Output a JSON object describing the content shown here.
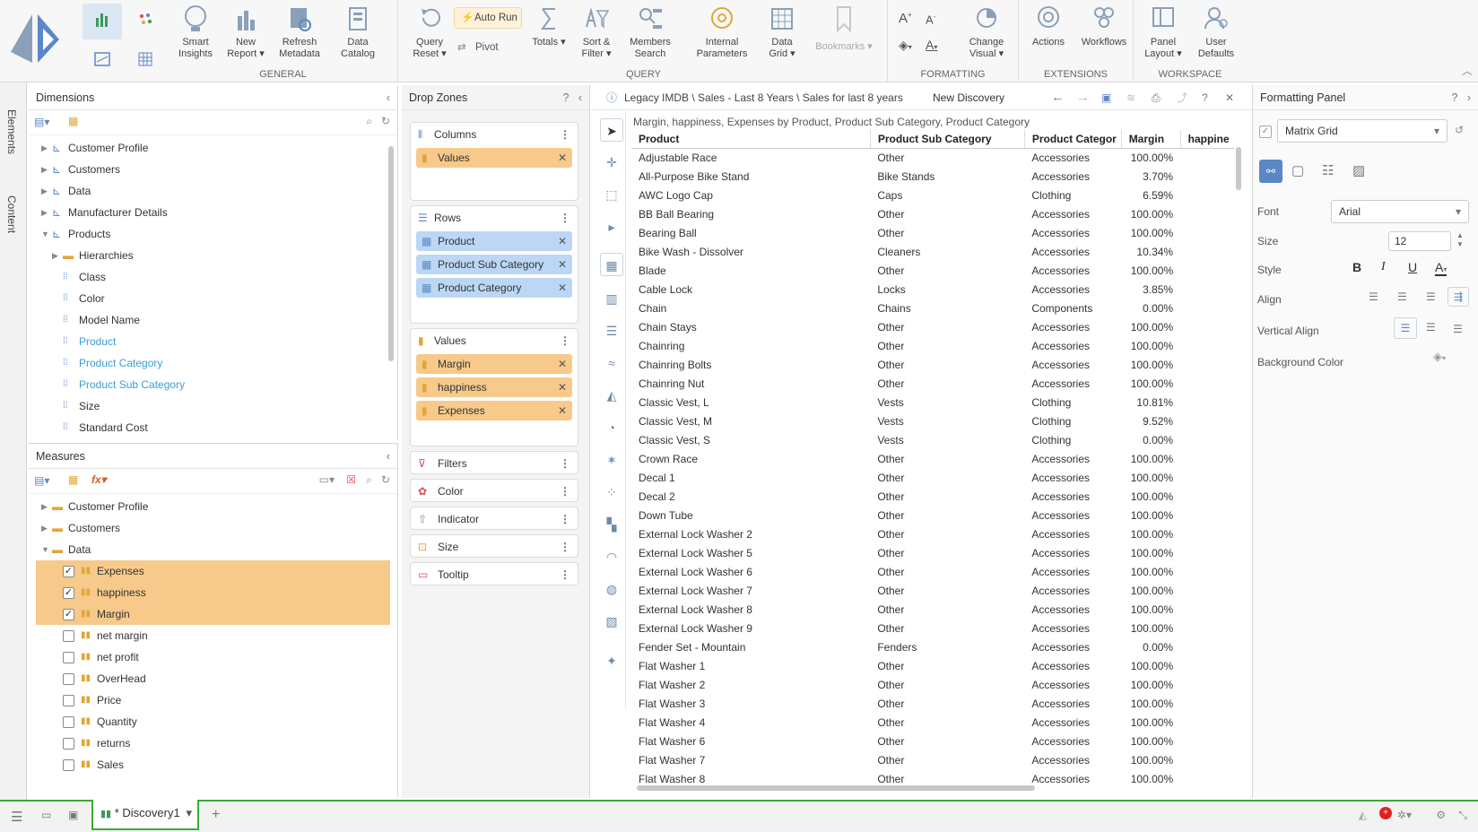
{
  "ribbon": {
    "groups": {
      "general": "GENERAL",
      "query": "QUERY",
      "formatting": "FORMATTING",
      "extensions": "EXTENSIONS",
      "workspace": "WORKSPACE"
    },
    "buttons": {
      "smart_insights": [
        "Smart",
        "Insights"
      ],
      "new_report": [
        "New",
        "Report ▾"
      ],
      "refresh_metadata": [
        "Refresh",
        "Metadata"
      ],
      "data_catalog": [
        "Data",
        "Catalog"
      ],
      "query_reset": [
        "Query",
        "Reset ▾"
      ],
      "auto_run": "Auto Run",
      "pivot": "Pivot",
      "totals": "Totals ▾",
      "sort_filter": [
        "Sort &",
        "Filter ▾"
      ],
      "members_search": [
        "Members",
        "Search"
      ],
      "internal_parameters": [
        "Internal",
        "Parameters"
      ],
      "data_grid": [
        "Data",
        "Grid ▾"
      ],
      "bookmarks": "Bookmarks ▾",
      "change_visual": [
        "Change",
        "Visual ▾"
      ],
      "actions": "Actions",
      "workflows": "Workflows",
      "panel_layout": [
        "Panel",
        "Layout ▾"
      ],
      "user_defaults": [
        "User",
        "Defaults"
      ]
    }
  },
  "side_tabs": {
    "elements": "Elements",
    "content": "Content"
  },
  "dimensions": {
    "title": "Dimensions",
    "items": [
      {
        "label": "Customer Profile",
        "level": 0,
        "type": "hier",
        "expanded": false
      },
      {
        "label": "Customers",
        "level": 0,
        "type": "hier",
        "expanded": false
      },
      {
        "label": "Data",
        "level": 0,
        "type": "hier",
        "expanded": false
      },
      {
        "label": "Manufacturer Details",
        "level": 0,
        "type": "hier",
        "expanded": false
      },
      {
        "label": "Products",
        "level": 0,
        "type": "hier",
        "expanded": true
      },
      {
        "label": "Hierarchies",
        "level": 1,
        "type": "folder",
        "expanded": false
      },
      {
        "label": "Class",
        "level": 1,
        "type": "attr"
      },
      {
        "label": "Color",
        "level": 1,
        "type": "attr"
      },
      {
        "label": "Model Name",
        "level": 1,
        "type": "attr"
      },
      {
        "label": "Product",
        "level": 1,
        "type": "attr",
        "active": true
      },
      {
        "label": "Product Category",
        "level": 1,
        "type": "attr",
        "active": true
      },
      {
        "label": "Product Sub Category",
        "level": 1,
        "type": "attr",
        "active": true
      },
      {
        "label": "Size",
        "level": 1,
        "type": "attr"
      },
      {
        "label": "Standard Cost",
        "level": 1,
        "type": "attr"
      }
    ]
  },
  "measures": {
    "title": "Measures",
    "items": [
      {
        "label": "Customer Profile",
        "level": 0,
        "type": "folder",
        "expanded": false
      },
      {
        "label": "Customers",
        "level": 0,
        "type": "folder",
        "expanded": false
      },
      {
        "label": "Data",
        "level": 0,
        "type": "folder",
        "expanded": true
      },
      {
        "label": "Expenses",
        "level": 1,
        "type": "measure",
        "checked": true
      },
      {
        "label": "happiness",
        "level": 1,
        "type": "measure",
        "checked": true
      },
      {
        "label": "Margin",
        "level": 1,
        "type": "measure",
        "checked": true
      },
      {
        "label": "net margin",
        "level": 1,
        "type": "measure",
        "checked": false
      },
      {
        "label": "net profit",
        "level": 1,
        "type": "measure",
        "checked": false
      },
      {
        "label": "OverHead",
        "level": 1,
        "type": "measure",
        "checked": false
      },
      {
        "label": "Price",
        "level": 1,
        "type": "measure",
        "checked": false
      },
      {
        "label": "Quantity",
        "level": 1,
        "type": "measure",
        "checked": false
      },
      {
        "label": "returns",
        "level": 1,
        "type": "measure",
        "checked": false
      },
      {
        "label": "Sales",
        "level": 1,
        "type": "measure",
        "checked": false
      }
    ]
  },
  "drop_zones": {
    "title": "Drop Zones",
    "columns": {
      "label": "Columns",
      "pills": [
        "Values"
      ]
    },
    "rows": {
      "label": "Rows",
      "pills": [
        "Product",
        "Product Sub Category",
        "Product Category"
      ]
    },
    "values": {
      "label": "Values",
      "pills": [
        "Margin",
        "happiness",
        "Expenses"
      ]
    },
    "filters": "Filters",
    "color": "Color",
    "indicator": "Indicator",
    "size": "Size",
    "tooltip": "Tooltip"
  },
  "report": {
    "path": "Legacy IMDB \\ Sales - Last 8 Years \\ Sales for last 8 years",
    "name": "New Discovery",
    "subtitle": "Margin, happiness, Expenses by Product, Product Sub Category, Product Category",
    "columns": [
      "Product",
      "Product Sub Category",
      "Product Categor",
      "Margin",
      "happine"
    ],
    "rows": [
      [
        "Adjustable Race",
        "Other",
        "Accessories",
        "100.00%"
      ],
      [
        "All-Purpose Bike Stand",
        "Bike Stands",
        "Accessories",
        "3.70%"
      ],
      [
        "AWC Logo Cap",
        "Caps",
        "Clothing",
        "6.59%"
      ],
      [
        "BB Ball Bearing",
        "Other",
        "Accessories",
        "100.00%"
      ],
      [
        "Bearing Ball",
        "Other",
        "Accessories",
        "100.00%"
      ],
      [
        "Bike Wash - Dissolver",
        "Cleaners",
        "Accessories",
        "10.34%"
      ],
      [
        "Blade",
        "Other",
        "Accessories",
        "100.00%"
      ],
      [
        "Cable Lock",
        "Locks",
        "Accessories",
        "3.85%"
      ],
      [
        "Chain",
        "Chains",
        "Components",
        "0.00%"
      ],
      [
        "Chain Stays",
        "Other",
        "Accessories",
        "100.00%"
      ],
      [
        "Chainring",
        "Other",
        "Accessories",
        "100.00%"
      ],
      [
        "Chainring Bolts",
        "Other",
        "Accessories",
        "100.00%"
      ],
      [
        "Chainring Nut",
        "Other",
        "Accessories",
        "100.00%"
      ],
      [
        "Classic Vest, L",
        "Vests",
        "Clothing",
        "10.81%"
      ],
      [
        "Classic Vest, M",
        "Vests",
        "Clothing",
        "9.52%"
      ],
      [
        "Classic Vest, S",
        "Vests",
        "Clothing",
        "0.00%"
      ],
      [
        "Crown Race",
        "Other",
        "Accessories",
        "100.00%"
      ],
      [
        "Decal 1",
        "Other",
        "Accessories",
        "100.00%"
      ],
      [
        "Decal 2",
        "Other",
        "Accessories",
        "100.00%"
      ],
      [
        "Down Tube",
        "Other",
        "Accessories",
        "100.00%"
      ],
      [
        "External Lock Washer 2",
        "Other",
        "Accessories",
        "100.00%"
      ],
      [
        "External Lock Washer 5",
        "Other",
        "Accessories",
        "100.00%"
      ],
      [
        "External Lock Washer 6",
        "Other",
        "Accessories",
        "100.00%"
      ],
      [
        "External Lock Washer 7",
        "Other",
        "Accessories",
        "100.00%"
      ],
      [
        "External Lock Washer 8",
        "Other",
        "Accessories",
        "100.00%"
      ],
      [
        "External Lock Washer 9",
        "Other",
        "Accessories",
        "100.00%"
      ],
      [
        "Fender Set - Mountain",
        "Fenders",
        "Accessories",
        "0.00%"
      ],
      [
        "Flat Washer 1",
        "Other",
        "Accessories",
        "100.00%"
      ],
      [
        "Flat Washer 2",
        "Other",
        "Accessories",
        "100.00%"
      ],
      [
        "Flat Washer 3",
        "Other",
        "Accessories",
        "100.00%"
      ],
      [
        "Flat Washer 4",
        "Other",
        "Accessories",
        "100.00%"
      ],
      [
        "Flat Washer 6",
        "Other",
        "Accessories",
        "100.00%"
      ],
      [
        "Flat Washer 7",
        "Other",
        "Accessories",
        "100.00%"
      ],
      [
        "Flat Washer 8",
        "Other",
        "Accessories",
        "100.00%"
      ]
    ]
  },
  "formatting_panel": {
    "title": "Formatting Panel",
    "visual_type": "Matrix Grid",
    "font_label": "Font",
    "font_value": "Arial",
    "size_label": "Size",
    "size_value": "12",
    "style_label": "Style",
    "align_label": "Align",
    "valign_label": "Vertical Align",
    "bg_label": "Background Color"
  },
  "statusbar": {
    "tab_label": "* Discovery1"
  },
  "colors": {
    "accent": "#5b87c7",
    "measure": "#f7c98a",
    "dimension": "#bcd7f5",
    "tab_border": "#3aaa35"
  }
}
